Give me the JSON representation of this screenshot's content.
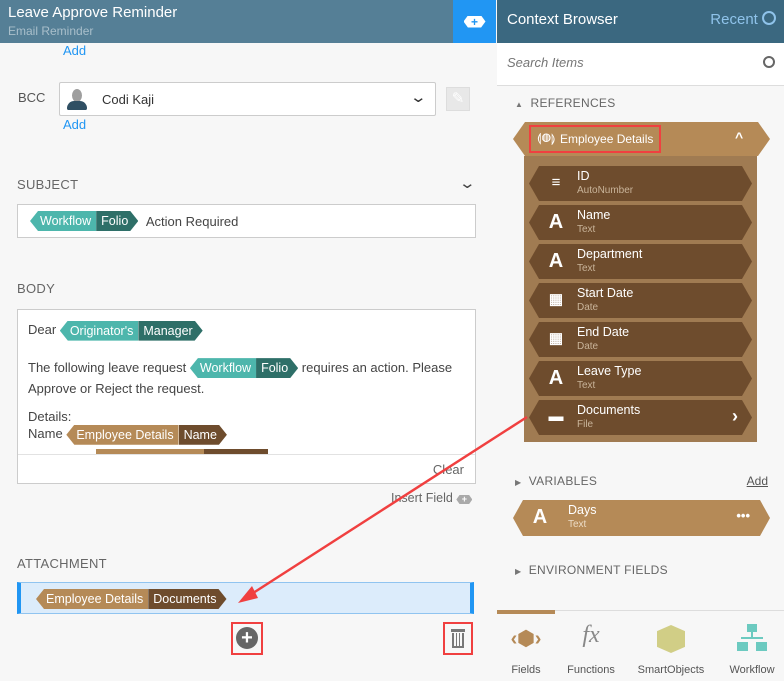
{
  "header": {
    "title": "Leave Approve Reminder",
    "subtitle": "Email Reminder"
  },
  "recipients": {
    "add_top": "Add",
    "bcc_label": "BCC",
    "bcc_value": "Codi Kaji",
    "add_bcc": "Add"
  },
  "subject": {
    "label": "SUBJECT",
    "token": {
      "a": "Workflow",
      "b": "Folio"
    },
    "text": "Action Required"
  },
  "body": {
    "label": "BODY",
    "dear": "Dear",
    "token1": {
      "a": "Originator's",
      "b": "Manager"
    },
    "line1_pre": "The following leave request",
    "token2": {
      "a": "Workflow",
      "b": "Folio"
    },
    "line1_post": "requires an action. Please Approve or Reject the request.",
    "details": "Details:",
    "name_label": "Name",
    "token3": {
      "a": "Employee Details",
      "b": "Name"
    },
    "clear": "Clear",
    "insert_field": "Insert Field"
  },
  "attachment": {
    "label": "ATTACHMENT",
    "token": {
      "a": "Employee Details",
      "b": "Documents"
    }
  },
  "context": {
    "title": "Context Browser",
    "recent": "Recent",
    "search_placeholder": "Search Items",
    "references": "REFERENCES",
    "ref_name": "Employee Details",
    "fields": [
      {
        "name": "ID",
        "type": "AutoNumber",
        "icon": "list-number-icon"
      },
      {
        "name": "Name",
        "type": "Text",
        "icon": "text-icon"
      },
      {
        "name": "Department",
        "type": "Text",
        "icon": "text-icon"
      },
      {
        "name": "Start Date",
        "type": "Date",
        "icon": "calendar-icon"
      },
      {
        "name": "End Date",
        "type": "Date",
        "icon": "calendar-icon"
      },
      {
        "name": "Leave Type",
        "type": "Text",
        "icon": "text-icon"
      },
      {
        "name": "Documents",
        "type": "File",
        "icon": "folder-icon"
      }
    ],
    "variables": "VARIABLES",
    "var_add": "Add",
    "var": {
      "name": "Days",
      "type": "Text"
    },
    "env": "ENVIRONMENT FIELDS"
  },
  "tabs": [
    {
      "label": "Fields"
    },
    {
      "label": "Functions"
    },
    {
      "label": "SmartObjects"
    },
    {
      "label": "Workflow"
    }
  ],
  "colors": {
    "accent": "#2196f3",
    "reference": "#b58a57",
    "reference_dark": "#6e4c2d",
    "workflow": "#4db6ac",
    "annotation": "#f04040"
  }
}
